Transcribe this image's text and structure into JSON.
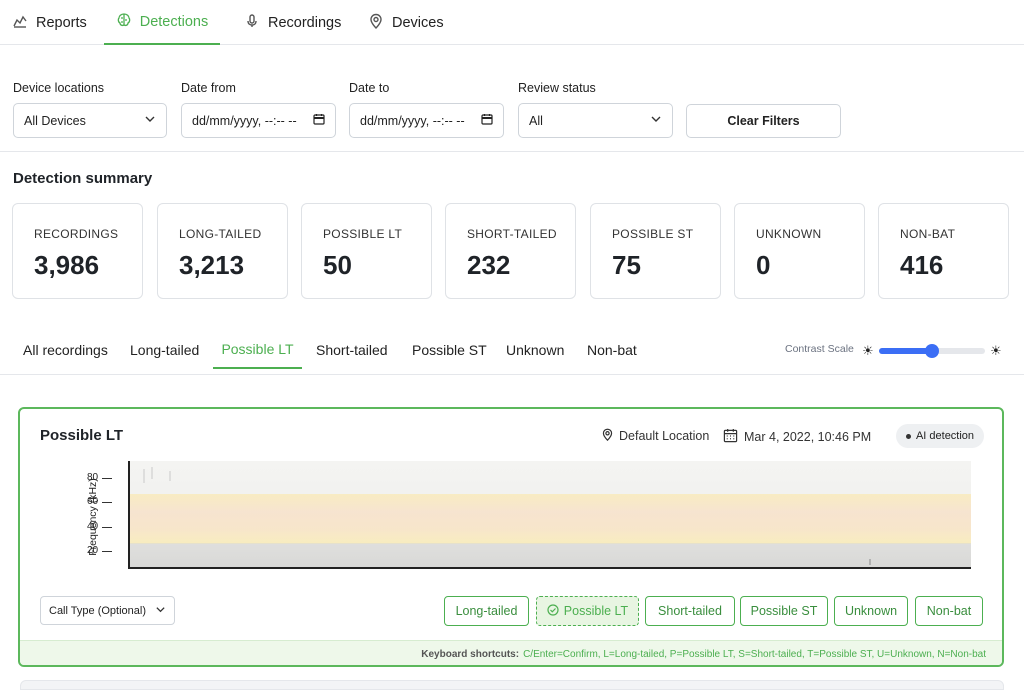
{
  "nav": {
    "tabs": [
      {
        "label": "Reports",
        "icon": "chart-line-icon"
      },
      {
        "label": "Detections",
        "icon": "brain-icon",
        "active": true
      },
      {
        "label": "Recordings",
        "icon": "microphone-icon"
      },
      {
        "label": "Devices",
        "icon": "location-pin-icon"
      }
    ]
  },
  "filters": {
    "device_label": "Device locations",
    "device_value": "All Devices",
    "date_from_label": "Date from",
    "date_from_value": "dd/mm/yyyy, --:-- --",
    "date_to_label": "Date to",
    "date_to_value": "dd/mm/yyyy, --:-- --",
    "review_label": "Review status",
    "review_value": "All",
    "clear_label": "Clear Filters"
  },
  "summary": {
    "title": "Detection summary",
    "cards": [
      {
        "label": "RECORDINGS",
        "value": "3,986"
      },
      {
        "label": "LONG-TAILED",
        "value": "3,213"
      },
      {
        "label": "POSSIBLE LT",
        "value": "50"
      },
      {
        "label": "SHORT-TAILED",
        "value": "232"
      },
      {
        "label": "POSSIBLE ST",
        "value": "75"
      },
      {
        "label": "UNKNOWN",
        "value": "0"
      },
      {
        "label": "NON-BAT",
        "value": "416"
      }
    ]
  },
  "subtabs": {
    "items": [
      "All recordings",
      "Long-tailed",
      "Possible LT",
      "Short-tailed",
      "Possible ST",
      "Unknown",
      "Non-bat"
    ],
    "active": "Possible LT",
    "contrast_label": "Contrast Scale",
    "contrast_level": 0.5
  },
  "detection": {
    "title": "Possible LT",
    "location": "Default Location",
    "datetime": "Mar 4, 2022, 10:46 PM",
    "badge": "AI detection",
    "y_axis_label": "Frequency (kHz)",
    "y_ticks": [
      "80",
      "60",
      "40",
      "20"
    ],
    "call_type_placeholder": "Call Type (Optional)",
    "label_buttons": [
      "Long-tailed",
      "Possible LT",
      "Short-tailed",
      "Possible ST",
      "Unknown",
      "Non-bat"
    ],
    "selected_label": "Possible LT",
    "shortcuts_title": "Keyboard shortcuts:",
    "shortcuts_keys": "C/Enter=Confirm, L=Long-tailed, P=Possible LT, S=Short-tailed, T=Possible ST, U=Unknown, N=Non-bat"
  },
  "colors": {
    "accent": "#4caf50",
    "slider": "#3b6ef5"
  }
}
